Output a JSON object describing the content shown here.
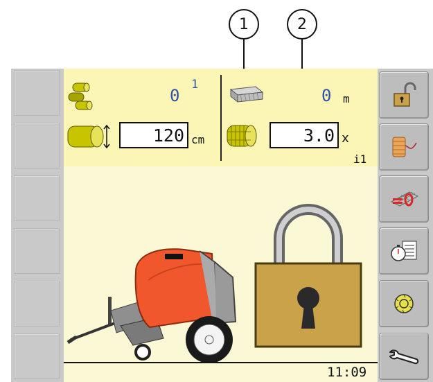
{
  "callouts": [
    {
      "label": "1"
    },
    {
      "label": "2"
    }
  ],
  "info": {
    "bale_count_value": "0",
    "bale_count_superscript": "1",
    "net_length_value": "0",
    "net_length_unit": "m",
    "bale_diameter_value": "120",
    "bale_diameter_unit": "cm",
    "net_wraps_value": "3.0",
    "net_wraps_unit": "x",
    "counter_index": "i1"
  },
  "status": {
    "time": "11:09"
  },
  "side_buttons": {
    "right": [
      "unlock-icon",
      "twine-spool-icon",
      "net-reset-icon",
      "timer-report-icon",
      "knife-disc-icon",
      "wrench-icon"
    ],
    "left_count": 6
  },
  "colors": {
    "info_panel": "#fbf6b6",
    "scene_bg": "#fbf8d6",
    "value_blue": "#2f4fa8",
    "baler_orange": "#f0572c",
    "lock_gold": "#c9a24a"
  }
}
